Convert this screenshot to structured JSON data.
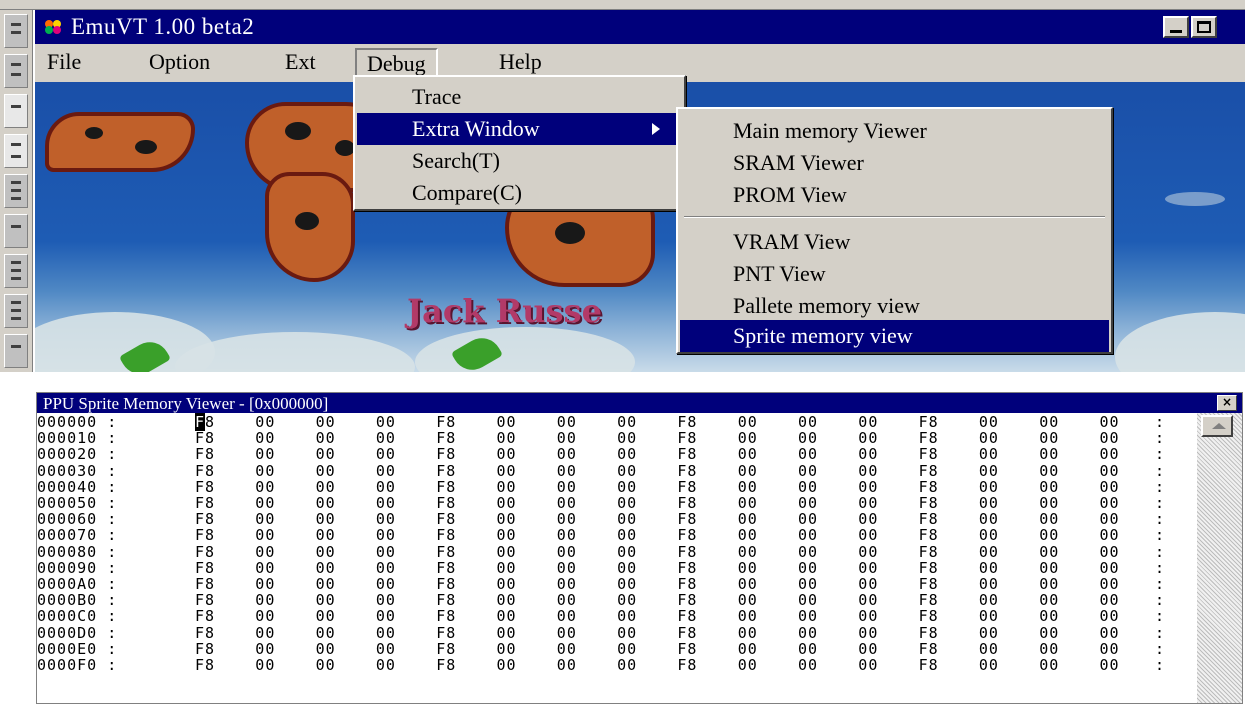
{
  "emulator": {
    "title": "EmuVT 1.00 beta2",
    "menubar": [
      "File",
      "Option",
      "Ext",
      "Debug",
      "Help"
    ],
    "game_text": "Jack Russe"
  },
  "debug_menu": {
    "items": [
      "Trace",
      "Extra Window",
      "Search(T)",
      "Compare(C)"
    ],
    "selected": "Extra Window"
  },
  "extra_window_menu": {
    "group1": [
      "Main memory Viewer",
      "SRAM Viewer",
      "PROM View"
    ],
    "group2": [
      "VRAM View",
      "PNT View",
      "Pallete memory view",
      "Sprite memory view"
    ],
    "selected": "Sprite memory view"
  },
  "viewer": {
    "title": "PPU Sprite Memory Viewer - [0x000000]",
    "close_glyph": "×",
    "separator": ":",
    "rows": [
      {
        "addr": "000000 :",
        "bytes": [
          "F8",
          "00",
          "00",
          "00",
          "F8",
          "00",
          "00",
          "00",
          "F8",
          "00",
          "00",
          "00",
          "F8",
          "00",
          "00",
          "00"
        ]
      },
      {
        "addr": "000010 :",
        "bytes": [
          "F8",
          "00",
          "00",
          "00",
          "F8",
          "00",
          "00",
          "00",
          "F8",
          "00",
          "00",
          "00",
          "F8",
          "00",
          "00",
          "00"
        ]
      },
      {
        "addr": "000020 :",
        "bytes": [
          "F8",
          "00",
          "00",
          "00",
          "F8",
          "00",
          "00",
          "00",
          "F8",
          "00",
          "00",
          "00",
          "F8",
          "00",
          "00",
          "00"
        ]
      },
      {
        "addr": "000030 :",
        "bytes": [
          "F8",
          "00",
          "00",
          "00",
          "F8",
          "00",
          "00",
          "00",
          "F8",
          "00",
          "00",
          "00",
          "F8",
          "00",
          "00",
          "00"
        ]
      },
      {
        "addr": "000040 :",
        "bytes": [
          "F8",
          "00",
          "00",
          "00",
          "F8",
          "00",
          "00",
          "00",
          "F8",
          "00",
          "00",
          "00",
          "F8",
          "00",
          "00",
          "00"
        ]
      },
      {
        "addr": "000050 :",
        "bytes": [
          "F8",
          "00",
          "00",
          "00",
          "F8",
          "00",
          "00",
          "00",
          "F8",
          "00",
          "00",
          "00",
          "F8",
          "00",
          "00",
          "00"
        ]
      },
      {
        "addr": "000060 :",
        "bytes": [
          "F8",
          "00",
          "00",
          "00",
          "F8",
          "00",
          "00",
          "00",
          "F8",
          "00",
          "00",
          "00",
          "F8",
          "00",
          "00",
          "00"
        ]
      },
      {
        "addr": "000070 :",
        "bytes": [
          "F8",
          "00",
          "00",
          "00",
          "F8",
          "00",
          "00",
          "00",
          "F8",
          "00",
          "00",
          "00",
          "F8",
          "00",
          "00",
          "00"
        ]
      },
      {
        "addr": "000080 :",
        "bytes": [
          "F8",
          "00",
          "00",
          "00",
          "F8",
          "00",
          "00",
          "00",
          "F8",
          "00",
          "00",
          "00",
          "F8",
          "00",
          "00",
          "00"
        ]
      },
      {
        "addr": "000090 :",
        "bytes": [
          "F8",
          "00",
          "00",
          "00",
          "F8",
          "00",
          "00",
          "00",
          "F8",
          "00",
          "00",
          "00",
          "F8",
          "00",
          "00",
          "00"
        ]
      },
      {
        "addr": "0000A0 :",
        "bytes": [
          "F8",
          "00",
          "00",
          "00",
          "F8",
          "00",
          "00",
          "00",
          "F8",
          "00",
          "00",
          "00",
          "F8",
          "00",
          "00",
          "00"
        ]
      },
      {
        "addr": "0000B0 :",
        "bytes": [
          "F8",
          "00",
          "00",
          "00",
          "F8",
          "00",
          "00",
          "00",
          "F8",
          "00",
          "00",
          "00",
          "F8",
          "00",
          "00",
          "00"
        ]
      },
      {
        "addr": "0000C0 :",
        "bytes": [
          "F8",
          "00",
          "00",
          "00",
          "F8",
          "00",
          "00",
          "00",
          "F8",
          "00",
          "00",
          "00",
          "F8",
          "00",
          "00",
          "00"
        ]
      },
      {
        "addr": "0000D0 :",
        "bytes": [
          "F8",
          "00",
          "00",
          "00",
          "F8",
          "00",
          "00",
          "00",
          "F8",
          "00",
          "00",
          "00",
          "F8",
          "00",
          "00",
          "00"
        ]
      },
      {
        "addr": "0000E0 :",
        "bytes": [
          "F8",
          "00",
          "00",
          "00",
          "F8",
          "00",
          "00",
          "00",
          "F8",
          "00",
          "00",
          "00",
          "F8",
          "00",
          "00",
          "00"
        ]
      },
      {
        "addr": "0000F0 :",
        "bytes": [
          "F8",
          "00",
          "00",
          "00",
          "F8",
          "00",
          "00",
          "00",
          "F8",
          "00",
          "00",
          "00",
          "F8",
          "00",
          "00",
          "00"
        ]
      }
    ]
  },
  "colors": {
    "titlebar": "#00007b",
    "menu_face": "#d4d0c8",
    "selection": "#00007b"
  }
}
